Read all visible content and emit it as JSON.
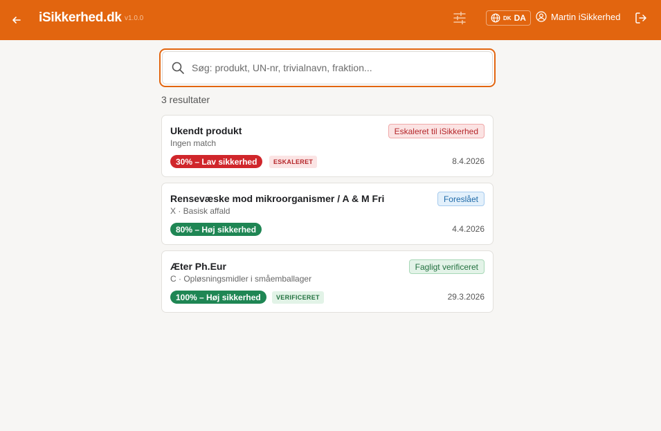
{
  "header": {
    "brand": "iSikkerhed.dk",
    "version": "v1.0.0",
    "lang_country": "DK",
    "lang": "DA",
    "user": "Martin iSikkerhed"
  },
  "search": {
    "placeholder": "Søg: produkt, UN-nr, trivialnavn, fraktion...",
    "value": ""
  },
  "results_count": "3 resultater",
  "results": [
    {
      "title": "Ukendt produkt",
      "subtitle": "Ingen match",
      "status": "Eskaleret til iSikkerhed",
      "confidence": "30% – Lav sikkerhed",
      "tag": "ESKALERET",
      "date": "8.4.2026"
    },
    {
      "title": "Rensevæske mod mikroorganismer / A & M Fri",
      "subtitle": "X · Basisk affald",
      "status": "Foreslået",
      "confidence": "80% – Høj sikkerhed",
      "tag": "",
      "date": "4.4.2026"
    },
    {
      "title": "Æter Ph.Eur",
      "subtitle": "C · Opløsningsmidler i småemballager",
      "status": "Fagligt verificeret",
      "confidence": "100% – Høj sikkerhed",
      "tag": "VERIFICERET",
      "date": "29.3.2026"
    }
  ],
  "colors": {
    "accent": "#e2650f",
    "danger": "#d0262b",
    "success": "#1f8654",
    "info": "#1f6aa8"
  },
  "icons": [
    "arrow-left-icon",
    "sliders-icon",
    "globe-icon",
    "user-icon",
    "logout-icon",
    "search-icon"
  ]
}
